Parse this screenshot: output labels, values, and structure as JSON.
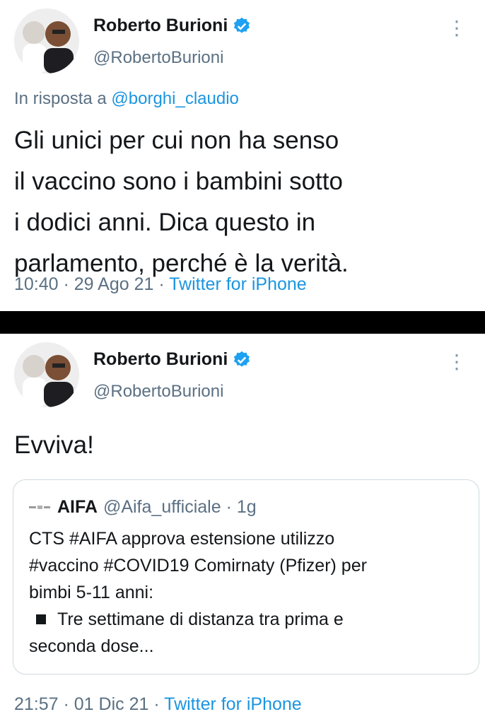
{
  "tweet1": {
    "name": "Roberto Burioni",
    "handle": "@RobertoBurioni",
    "more_icon": "⋮",
    "reply_prefix": "In risposta a",
    "reply_mention": "@borghi_claudio",
    "body_lines": [
      "Gli unici per cui non ha senso",
      "il vaccino sono i bambini sotto",
      "i dodici anni. Dica questo in",
      "parlamento, perché è la verità."
    ],
    "time": "10:40 · 29 Ago 21 · ",
    "source": "Twitter for iPhone"
  },
  "tweet2": {
    "name": "Roberto Burioni",
    "handle": "@RobertoBurioni",
    "more_icon": "⋮",
    "body": "Evviva!",
    "quote": {
      "name": "AIFA",
      "handle": "@Aifa_ufficiale · 1g",
      "line1": "CTS #AIFA approva estensione utilizzo",
      "line2": "#vaccino #COVID19 Comirnaty (Pfizer) per",
      "line3": "bimbi 5-11 anni:",
      "line4": "Tre settimane di distanza tra prima e",
      "line5": "seconda dose..."
    },
    "time": "21:57 · 01 Dic 21 · ",
    "source": "Twitter for iPhone"
  },
  "colors": {
    "link": "#1b95e0",
    "secondary_text": "#5b7083",
    "verified": "#1da1f2",
    "divider": "#000000"
  },
  "icons": [
    "verified-badge-icon",
    "more-options-icon",
    "aifa-logo-icon"
  ]
}
